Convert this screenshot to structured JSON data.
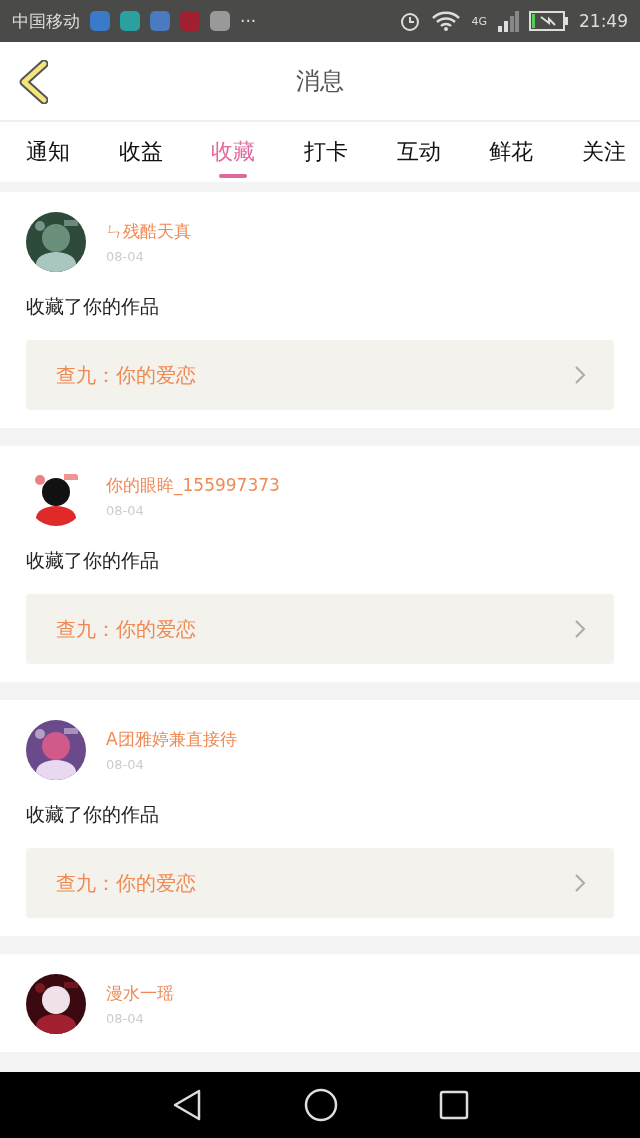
{
  "status_bar": {
    "carrier": "中国移动",
    "more": "···",
    "network": "4G",
    "time": "21:49"
  },
  "header": {
    "title": "消息"
  },
  "tabs": [
    {
      "label": "通知",
      "selected": false
    },
    {
      "label": "收益",
      "selected": false
    },
    {
      "label": "收藏",
      "selected": true
    },
    {
      "label": "打卡",
      "selected": false
    },
    {
      "label": "互动",
      "selected": false
    },
    {
      "label": "鲜花",
      "selected": false
    },
    {
      "label": "关注",
      "selected": false
    }
  ],
  "messages": [
    {
      "name": "ㄣ残酷天真",
      "date": "08-04",
      "action": "收藏了你的作品",
      "work": "查九：你的爱恋"
    },
    {
      "name": "你的眼眸_155997373",
      "date": "08-04",
      "action": "收藏了你的作品",
      "work": "查九：你的爱恋"
    },
    {
      "name": "A团雅婷兼直接待",
      "date": "08-04",
      "action": "收藏了你的作品",
      "work": "查九：你的爱恋"
    },
    {
      "name": "漫水一瑶",
      "date": "08-04"
    }
  ]
}
